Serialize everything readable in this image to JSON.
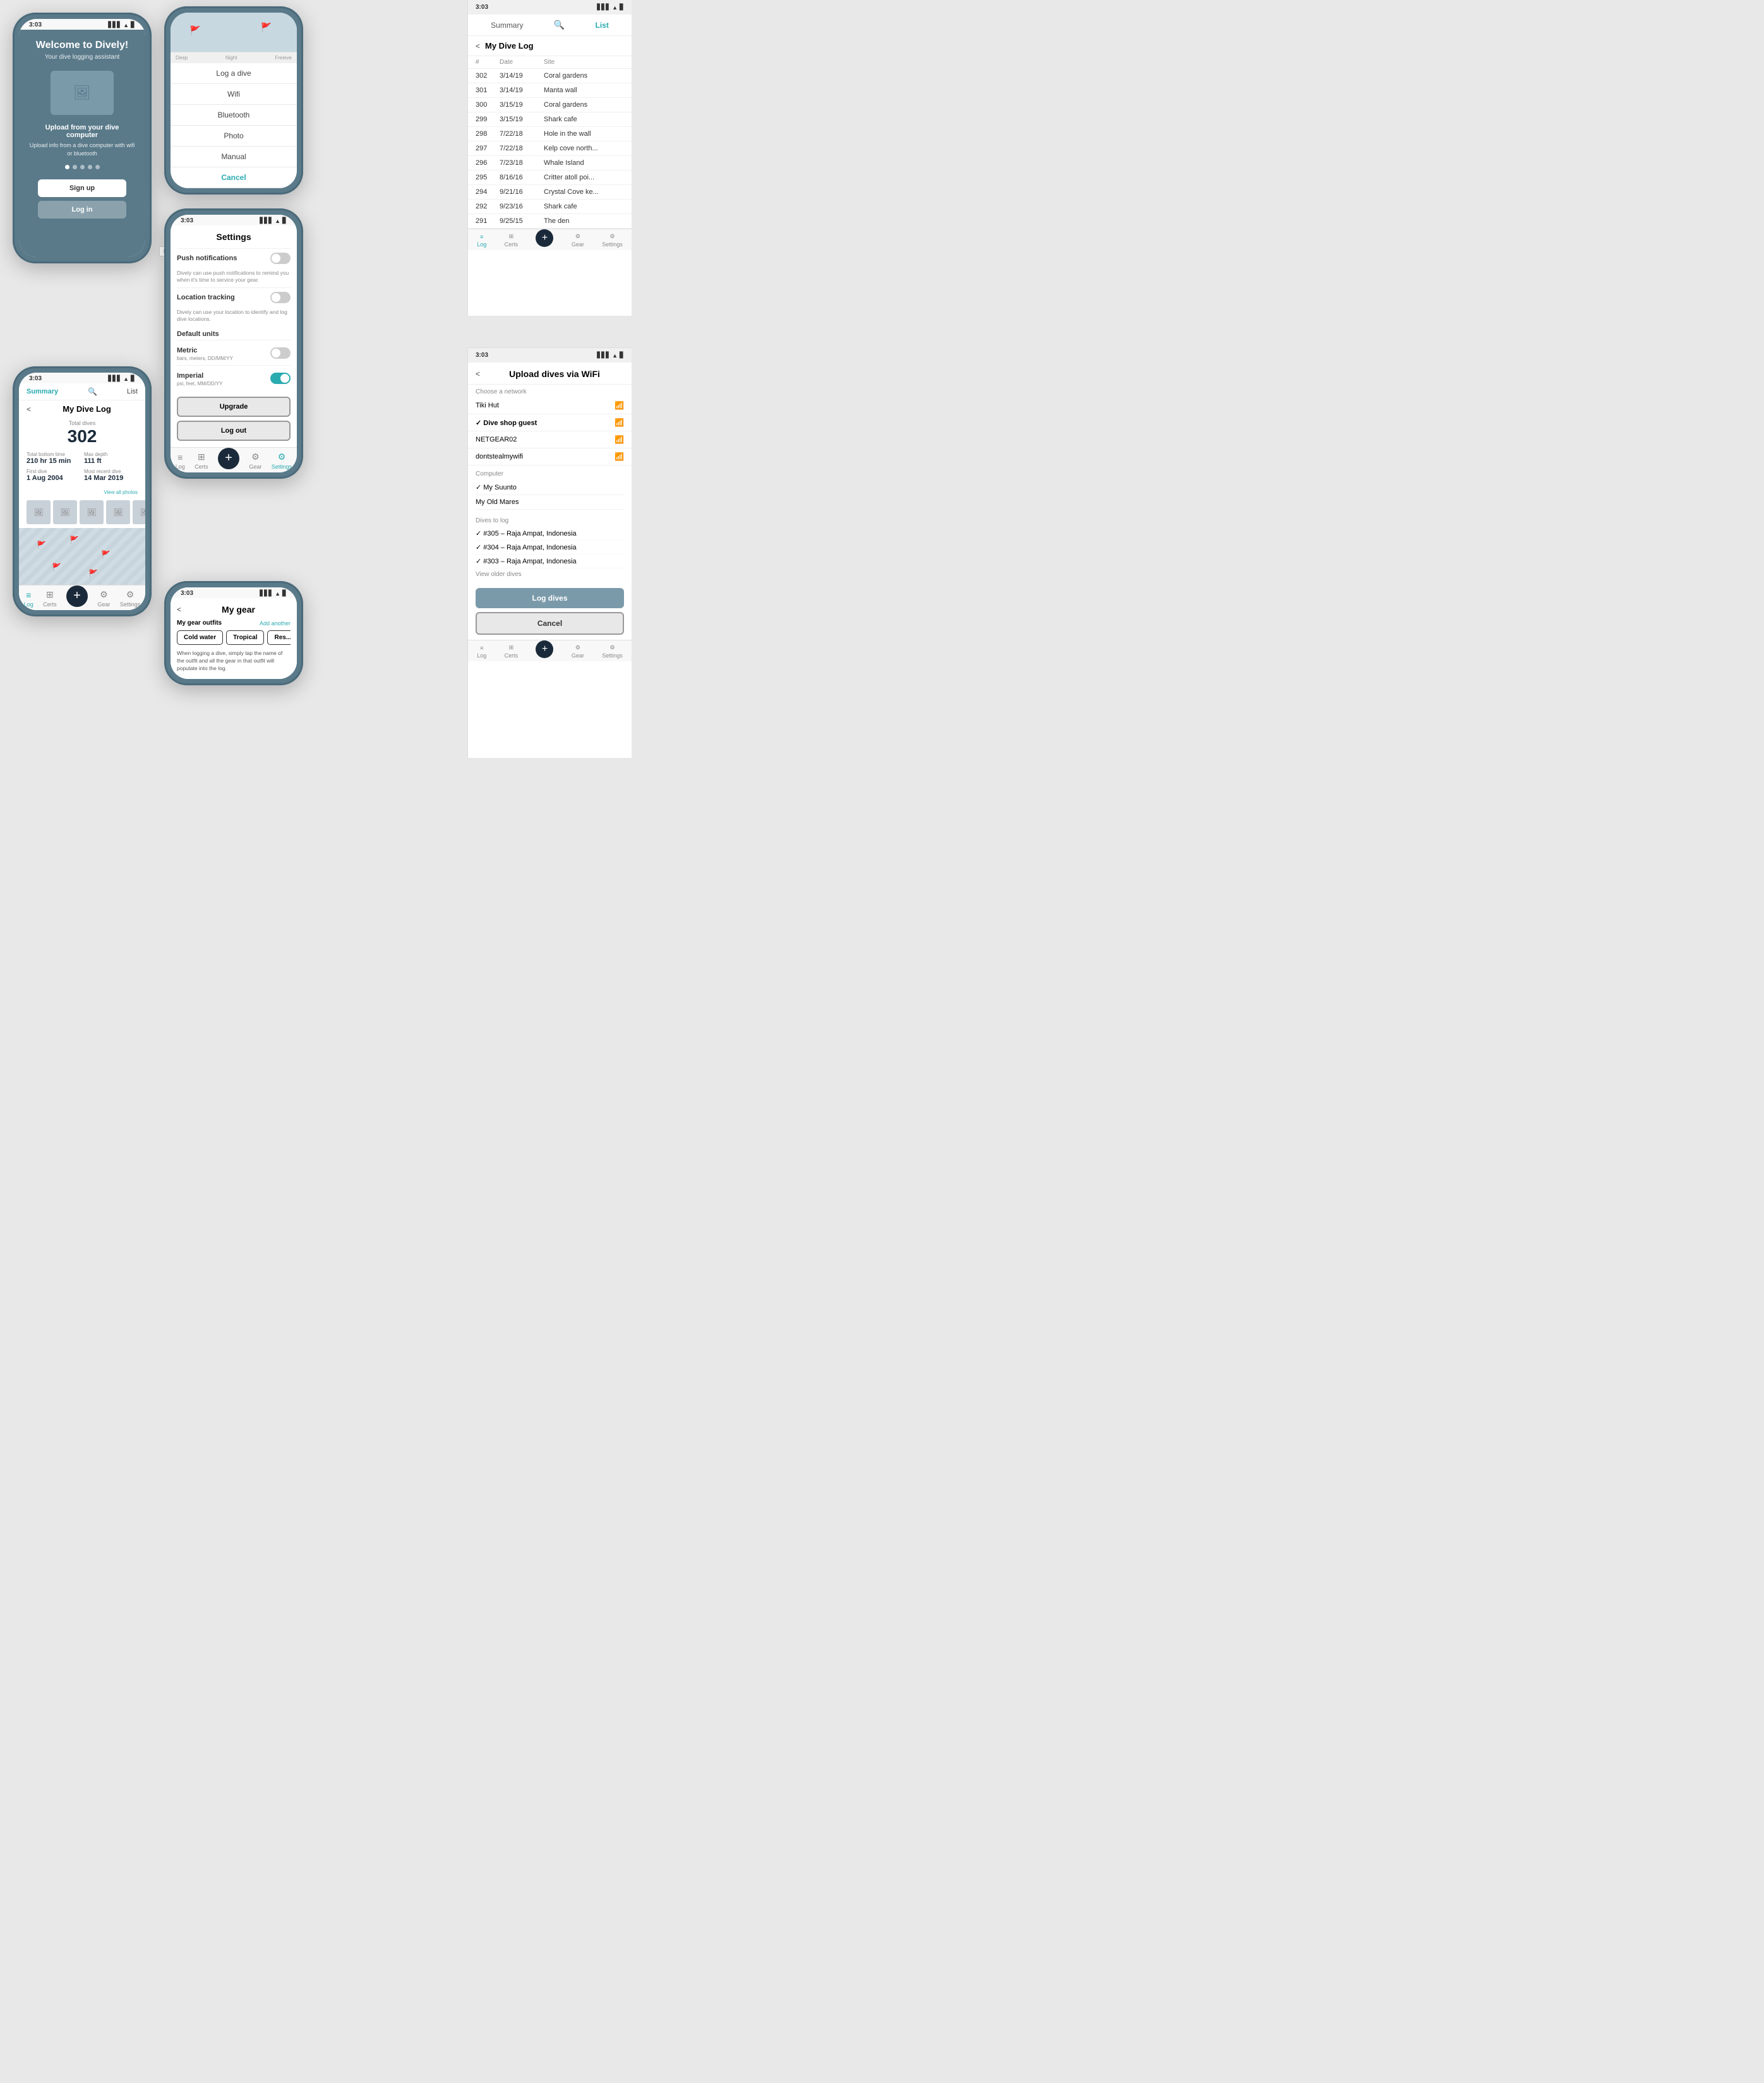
{
  "app": {
    "name": "Dively",
    "time": "3:03"
  },
  "phone1": {
    "title": "Welcome to Dively!",
    "subtitle": "Your dive logging assistant",
    "desc_title": "Upload from your dive computer",
    "desc": "Upload info from a dive computer with wifi or bluetooth",
    "btn_signup": "Sign up",
    "btn_login": "Log in"
  },
  "phone2": {
    "options": [
      "Log a dive",
      "Wifi",
      "Bluetooth",
      "Photo",
      "Manual",
      "Cancel"
    ],
    "status_left": "Deep",
    "status_mid": "Night",
    "status_right": "Freeive"
  },
  "phone3": {
    "header_summary": "Summary",
    "header_list": "List",
    "back": "<",
    "title": "My Dive Log",
    "total_label": "Total dives",
    "total_num": "302",
    "stats": [
      {
        "label": "Total bottom time",
        "value": "210 hr 15 min"
      },
      {
        "label": "Max depth",
        "value": "111 ft"
      },
      {
        "label": "First dive",
        "value": "1 Aug 2004"
      },
      {
        "label": "Most recent dive",
        "value": "14 Mar 2019"
      }
    ],
    "view_photos": "View all photos"
  },
  "phone4": {
    "title": "Settings",
    "push_notifications": {
      "label": "Push notifications",
      "desc": "Dively can use push notifications to remind you when it's time to service your gear.",
      "state": "off"
    },
    "location_tracking": {
      "label": "Location tracking",
      "desc": "Dively can use your location to identify and log dive locations.",
      "state": "off"
    },
    "default_units": "Default units",
    "metric": {
      "label": "Metric",
      "sub": "bars, meters, DD/MM/YY",
      "state": "off"
    },
    "imperial": {
      "label": "Imperial",
      "sub": "psi, feet, MM/DD/YY",
      "state": "on"
    },
    "btn_upgrade": "Upgrade",
    "btn_logout": "Log out"
  },
  "phone5": {
    "back": "<",
    "title": "My gear",
    "outfits_label": "My gear outfits",
    "add_another": "Add another",
    "chips": [
      "Cold water",
      "Tropical",
      "Res..."
    ],
    "desc": "When logging a dive, simply tap the name of the outfit and all the gear in that outfit will populate into the log."
  },
  "panel_list": {
    "tab_summary": "Summary",
    "tab_list": "List",
    "back": "<",
    "title": "My Dive Log",
    "col_num": "#",
    "col_date": "Date",
    "col_site": "Site",
    "dives": [
      {
        "num": "302",
        "date": "3/14/19",
        "site": "Coral gardens"
      },
      {
        "num": "301",
        "date": "3/14/19",
        "site": "Manta wall"
      },
      {
        "num": "300",
        "date": "3/15/19",
        "site": "Coral gardens"
      },
      {
        "num": "299",
        "date": "3/15/19",
        "site": "Shark cafe"
      },
      {
        "num": "298",
        "date": "7/22/18",
        "site": "Hole in the wall"
      },
      {
        "num": "297",
        "date": "7/22/18",
        "site": "Kelp cove north..."
      },
      {
        "num": "296",
        "date": "7/23/18",
        "site": "Whale Island"
      },
      {
        "num": "295",
        "date": "8/16/16",
        "site": "Critter atoll poi..."
      },
      {
        "num": "294",
        "date": "9/21/16",
        "site": "Crystal Cove ke..."
      },
      {
        "num": "292",
        "date": "9/23/16",
        "site": "Shark cafe"
      },
      {
        "num": "291",
        "date": "9/25/15",
        "site": "The den"
      }
    ],
    "tabs": [
      {
        "label": "Log",
        "icon": "≡",
        "active": true
      },
      {
        "label": "Certs",
        "icon": "⊞"
      },
      {
        "label": "Add dive",
        "icon": "+"
      },
      {
        "label": "Gear",
        "icon": "⚙"
      },
      {
        "label": "Settings",
        "icon": "⚙"
      }
    ]
  },
  "panel_wifi": {
    "back": "<",
    "title": "Upload dives via WiFi",
    "choose_network": "Choose a network",
    "networks": [
      {
        "name": "Tiki Hut",
        "selected": false
      },
      {
        "name": "Dive shop guest",
        "selected": true
      },
      {
        "name": "NETGEAR02",
        "selected": false
      },
      {
        "name": "dontstealmywifi",
        "selected": false
      }
    ],
    "computer_label": "Computer",
    "computers": [
      {
        "name": "My Suunto",
        "selected": true
      },
      {
        "name": "My Old Mares",
        "selected": false
      }
    ],
    "dives_label": "Dives to log",
    "dives": [
      {
        "label": "#305 – Raja Ampat, Indonesia",
        "checked": true
      },
      {
        "label": "#304 – Raja Ampat, Indonesia",
        "checked": true
      },
      {
        "label": "#303 – Raja Ampat, Indonesia",
        "checked": true
      }
    ],
    "view_older": "View older dives",
    "btn_log": "Log dives",
    "btn_cancel": "Cancel"
  },
  "labels": {
    "bluetooth": "Bluetooth"
  }
}
